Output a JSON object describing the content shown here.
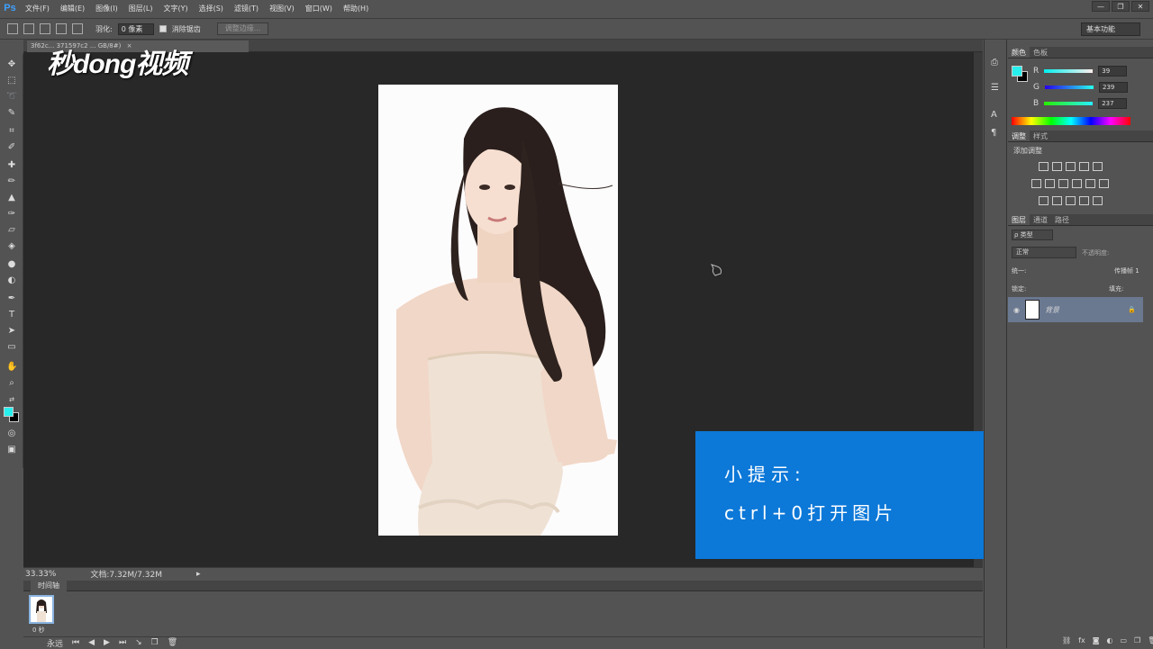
{
  "app": {
    "logo": "Ps"
  },
  "menu": [
    "文件(F)",
    "编辑(E)",
    "图像(I)",
    "图层(L)",
    "文字(Y)",
    "选择(S)",
    "滤镜(T)",
    "视图(V)",
    "窗口(W)",
    "帮助(H)"
  ],
  "window_controls": [
    "—",
    "❐",
    "✕"
  ],
  "options": {
    "feather_label": "羽化:",
    "feather_value": "0 像素",
    "antialias_label": "消除锯齿",
    "refine_edge_label": "调整边缘...",
    "workspace": "基本功能"
  },
  "document_tab": {
    "label": "3f62c... 371597c2 ... GB/8#)",
    "close": "×"
  },
  "watermark": "秒dong视频",
  "tip": {
    "title": "小提示:",
    "body": "ctrl+0打开图片"
  },
  "status": {
    "zoom": "33.33%",
    "doc_size": "文档:7.32M/7.32M"
  },
  "timeline": {
    "tab_label": "时间轴",
    "frame_time": "0 秒",
    "loop": "永远"
  },
  "color_panel": {
    "tabs": [
      "颜色",
      "色板"
    ],
    "fg_color": "#27efed",
    "r_label": "R",
    "r_value": "39",
    "g_label": "G",
    "g_value": "239",
    "b_label": "B",
    "b_value": "237"
  },
  "adjust_panel": {
    "tabs": [
      "调整",
      "样式"
    ],
    "add_label": "添加调整"
  },
  "layers_panel": {
    "tabs": [
      "图层",
      "通道",
      "路径"
    ],
    "filter_label": "ρ 类型",
    "blend_mode": "正常",
    "opacity_label": "不透明度:",
    "lock_label": "锁定:",
    "fill_label": "填充:",
    "unify_label": "统一:",
    "propagate_label": "传播帧 1",
    "layer_name": "背景"
  }
}
